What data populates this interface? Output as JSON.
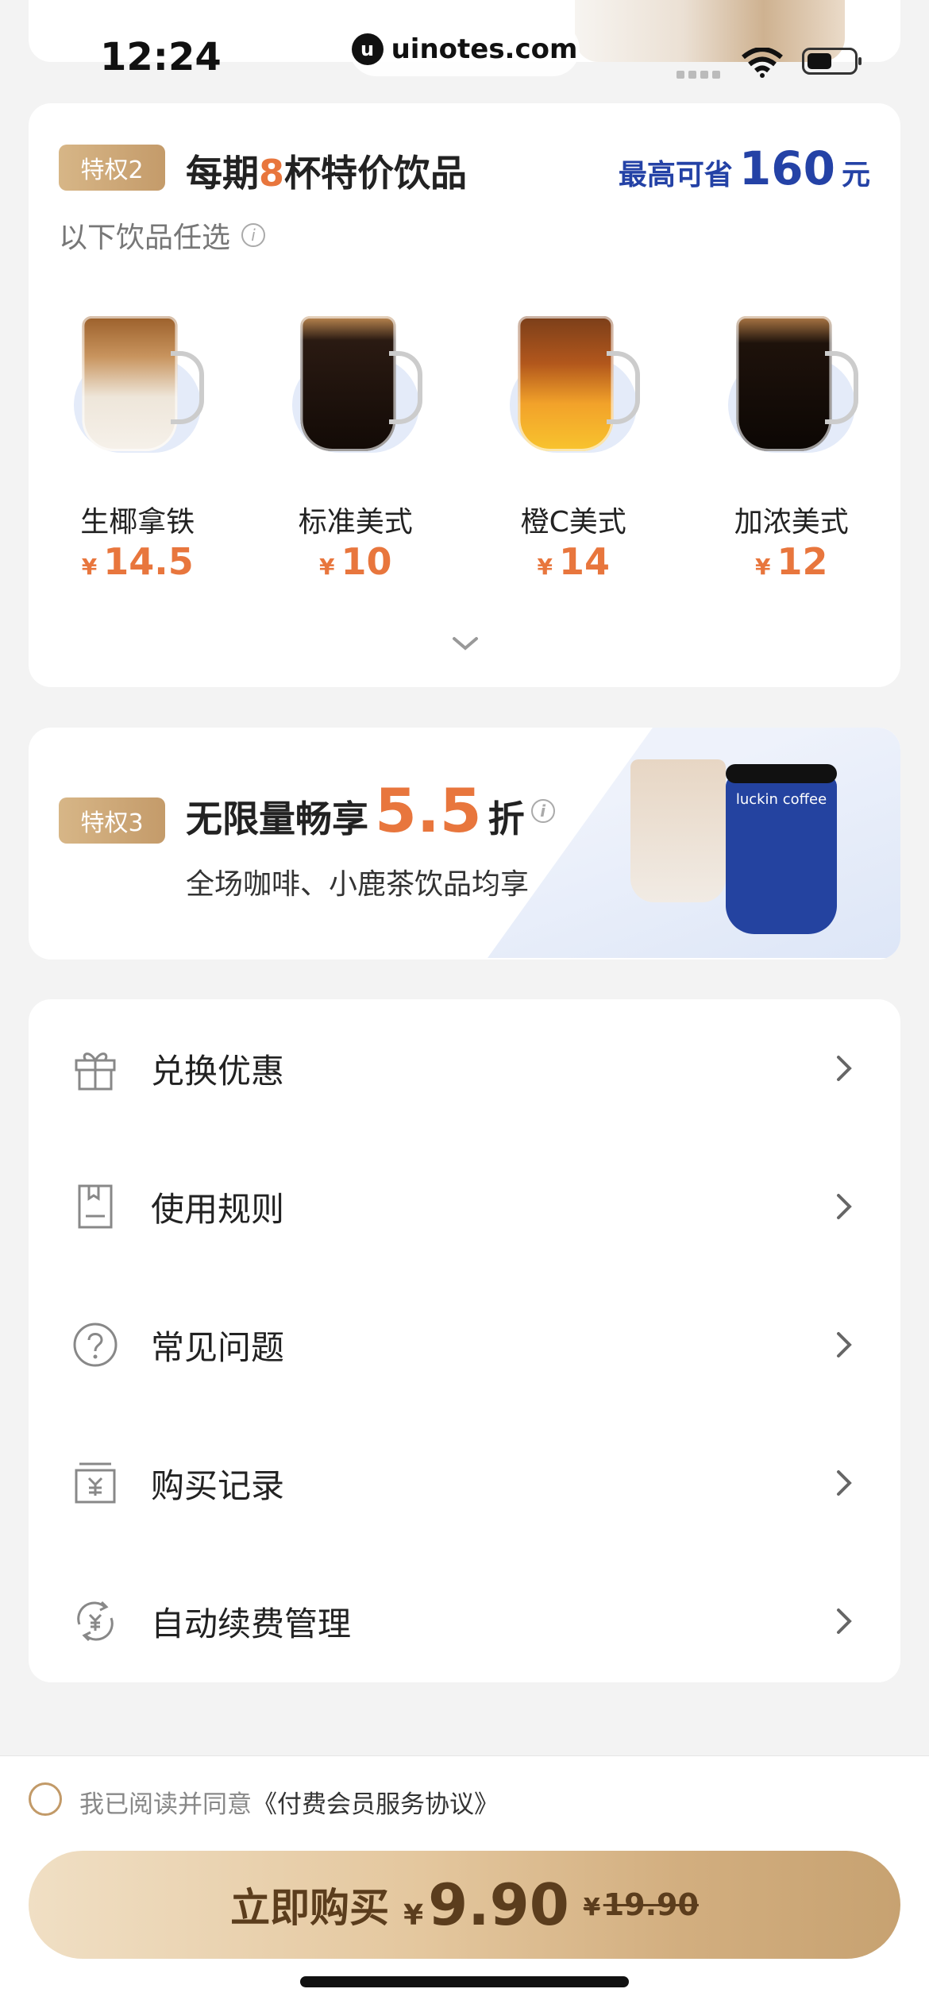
{
  "status_bar": {
    "time": "12:24",
    "url": "uinotes.com",
    "url_logo": "u"
  },
  "perk2": {
    "badge": "特权2",
    "title_pre": "每期",
    "title_num": "8",
    "title_post": "杯特价饮品",
    "save_label": "最高可省",
    "save_amount": "160",
    "save_unit": "元",
    "subtitle": "以下饮品任选",
    "drinks": [
      {
        "name": "生椰拿铁",
        "currency": "¥",
        "price": "14.5"
      },
      {
        "name": "标准美式",
        "currency": "¥",
        "price": "10"
      },
      {
        "name": "橙C美式",
        "currency": "¥",
        "price": "14"
      },
      {
        "name": "加浓美式",
        "currency": "¥",
        "price": "12"
      }
    ]
  },
  "perk3": {
    "badge": "特权3",
    "title_pre": "无限量畅享",
    "discount": "5.5",
    "title_post": "折",
    "subtitle": "全场咖啡、小鹿茶饮品均享",
    "cup_brand": "luckin coffee"
  },
  "menu": [
    {
      "icon": "gift-icon",
      "label": "兑换优惠"
    },
    {
      "icon": "rules-icon",
      "label": "使用规则"
    },
    {
      "icon": "question-icon",
      "label": "常见问题"
    },
    {
      "icon": "receipt-icon",
      "label": "购买记录"
    },
    {
      "icon": "renew-icon",
      "label": "自动续费管理"
    }
  ],
  "agreement": {
    "text": "我已阅读并同意",
    "link": "《付费会员服务协议》"
  },
  "buy": {
    "label": "立即购买",
    "currency": "¥",
    "price": "9.90",
    "old_currency": "¥",
    "old_price": "19.90"
  },
  "colors": {
    "accent_orange": "#e8763d",
    "accent_blue": "#2442a6",
    "gold": "#c49b6a"
  }
}
